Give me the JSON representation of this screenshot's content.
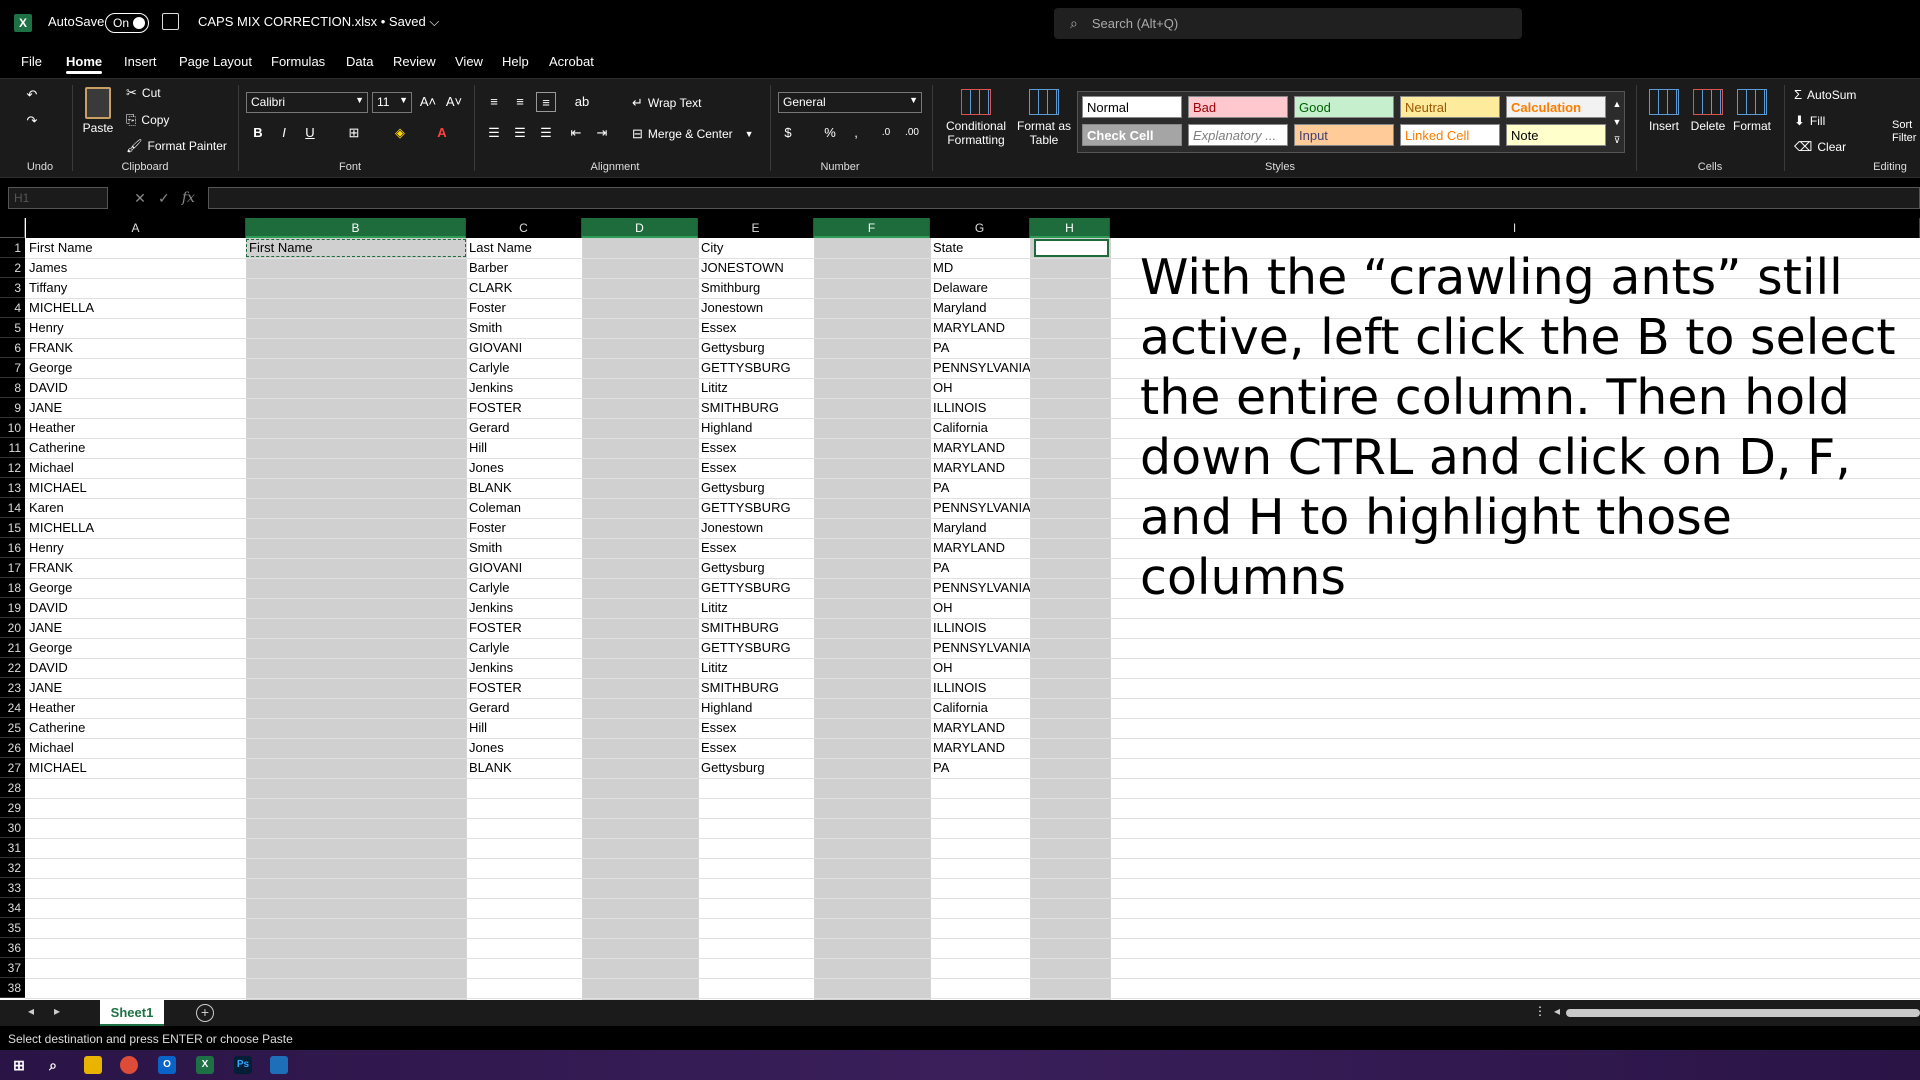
{
  "titlebar": {
    "autosave_label": "AutoSave",
    "autosave_state": "On",
    "filename": "CAPS MIX CORRECTION.xlsx • Saved ⌵",
    "search_placeholder": "Search (Alt+Q)"
  },
  "menu": [
    "File",
    "Home",
    "Insert",
    "Page Layout",
    "Formulas",
    "Data",
    "Review",
    "View",
    "Help",
    "Acrobat"
  ],
  "ribbon": {
    "undo_label": "Undo",
    "clipboard_label": "Clipboard",
    "paste": "Paste",
    "cut": "Cut",
    "copy": "Copy",
    "format_painter": "Format Painter",
    "font_label": "Font",
    "font_name": "Calibri",
    "font_size": "11",
    "alignment_label": "Alignment",
    "wrap_text": "Wrap Text",
    "merge_center": "Merge & Center",
    "number_label": "Number",
    "number_format": "General",
    "styles_label": "Styles",
    "conditional_formatting": "Conditional Formatting",
    "format_as_table": "Format as Table",
    "styles": [
      {
        "name": "Normal",
        "bg": "#ffffff",
        "fg": "#000000"
      },
      {
        "name": "Bad",
        "bg": "#ffc7ce",
        "fg": "#9c0006"
      },
      {
        "name": "Good",
        "bg": "#c6efce",
        "fg": "#006100"
      },
      {
        "name": "Neutral",
        "bg": "#ffeb9c",
        "fg": "#9c5700"
      },
      {
        "name": "Calculation",
        "bg": "#f2f2f2",
        "fg": "#fa7d00"
      },
      {
        "name": "Check Cell",
        "bg": "#a5a5a5",
        "fg": "#ffffff"
      },
      {
        "name": "Explanatory ...",
        "bg": "#ffffff",
        "fg": "#7f7f7f"
      },
      {
        "name": "Input",
        "bg": "#ffcc99",
        "fg": "#3f3f76"
      },
      {
        "name": "Linked Cell",
        "bg": "#ffffff",
        "fg": "#fa7d00"
      },
      {
        "name": "Note",
        "bg": "#ffffcc",
        "fg": "#000000"
      }
    ],
    "cells_label": "Cells",
    "insert": "Insert",
    "delete": "Delete",
    "format": "Format",
    "editing_label": "Editing",
    "autosum": "AutoSum",
    "fill": "Fill",
    "clear": "Clear",
    "sort": "Sort",
    "filter": "Filter"
  },
  "formula_bar": {
    "name_box": "H1",
    "fx": "fx"
  },
  "grid": {
    "columns": [
      "A",
      "B",
      "C",
      "D",
      "E",
      "F",
      "G",
      "H",
      "I"
    ],
    "rows": [
      "1",
      "2",
      "3",
      "4",
      "5",
      "6",
      "7",
      "8",
      "9",
      "10",
      "11",
      "12",
      "13",
      "14",
      "15",
      "16",
      "17",
      "18",
      "19",
      "20",
      "21",
      "22",
      "23",
      "24",
      "25",
      "26",
      "27",
      "28",
      "29",
      "30",
      "31",
      "32",
      "33",
      "34",
      "35",
      "36",
      "37",
      "38"
    ],
    "col_a": [
      "First Name",
      "James",
      "Tiffany",
      "MICHELLA",
      "Henry",
      "FRANK",
      "George",
      "DAVID",
      "JANE",
      "Heather",
      "Catherine",
      "Michael",
      "MICHAEL",
      "Karen",
      "MICHELLA",
      "Henry",
      "FRANK",
      "George",
      "DAVID",
      "JANE",
      "George",
      "DAVID",
      "JANE",
      "Heather",
      "Catherine",
      "Michael",
      "MICHAEL"
    ],
    "col_b": [
      "First Name"
    ],
    "col_c": [
      "Last Name",
      "Barber",
      "CLARK",
      "Foster",
      "Smith",
      "GIOVANI",
      "Carlyle",
      "Jenkins",
      "FOSTER",
      "Gerard",
      "Hill",
      "Jones",
      "BLANK",
      "Coleman",
      "Foster",
      "Smith",
      "GIOVANI",
      "Carlyle",
      "Jenkins",
      "FOSTER",
      "Carlyle",
      "Jenkins",
      "FOSTER",
      "Gerard",
      "Hill",
      "Jones",
      "BLANK"
    ],
    "col_e": [
      "City",
      "JONESTOWN",
      "Smithburg",
      "Jonestown",
      "Essex",
      "Gettysburg",
      "GETTYSBURG",
      "Lititz",
      "SMITHBURG",
      "Highland",
      "Essex",
      "Essex",
      "Gettysburg",
      "GETTYSBURG",
      "Jonestown",
      "Essex",
      "Gettysburg",
      "GETTYSBURG",
      "Lititz",
      "SMITHBURG",
      "GETTYSBURG",
      "Lititz",
      "SMITHBURG",
      "Highland",
      "Essex",
      "Essex",
      "Gettysburg"
    ],
    "col_g": [
      "State",
      "MD",
      "Delaware",
      "Maryland",
      "MARYLAND",
      "PA",
      "PENNSYLVANIA",
      "OH",
      "ILLINOIS",
      "California",
      "MARYLAND",
      "MARYLAND",
      "PA",
      "PENNSYLVANIA",
      "Maryland",
      "MARYLAND",
      "PA",
      "PENNSYLVANIA",
      "OH",
      "ILLINOIS",
      "PENNSYLVANIA",
      "OH",
      "ILLINOIS",
      "California",
      "MARYLAND",
      "MARYLAND",
      "PA"
    ]
  },
  "instruction": "With the “crawling ants” still active, left click the B to select the entire column. Then hold down CTRL and click on D, F, and H to highlight those columns",
  "sheets": [
    "Sheet1"
  ],
  "status": "Select destination and press ENTER or choose Paste"
}
